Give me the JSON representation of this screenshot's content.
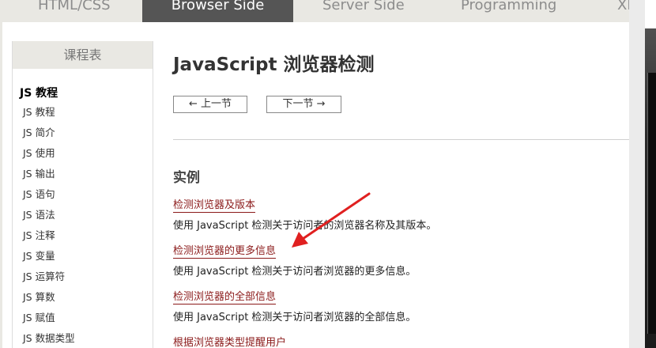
{
  "top_nav": {
    "tabs": [
      {
        "label": "HTML/CSS",
        "active": false
      },
      {
        "label": "Browser Side",
        "active": true
      },
      {
        "label": "Server Side",
        "active": false
      },
      {
        "label": "Programming",
        "active": false
      },
      {
        "label": "XI",
        "active": false
      }
    ]
  },
  "sidebar": {
    "header": "课程表",
    "group_title": "JS 教程",
    "items": [
      "JS 教程",
      "JS 简介",
      "JS 使用",
      "JS 输出",
      "JS 语句",
      "JS 语法",
      "JS 注释",
      "JS 变量",
      "JS 运算符",
      "JS 算数",
      "JS 赋值",
      "JS 数据类型"
    ]
  },
  "main": {
    "title": "JavaScript 浏览器检测",
    "prev_label": "上一节",
    "next_label": "下一节",
    "section_title": "实例",
    "examples": [
      {
        "link": "检测浏览器及版本",
        "desc": "使用 JavaScript 检测关于访问者的浏览器名称及其版本。"
      },
      {
        "link": "检测浏览器的更多信息",
        "desc": "使用 JavaScript 检测关于访问者浏览器的更多信息。"
      },
      {
        "link": "检测浏览器的全部信息",
        "desc": "使用 JavaScript 检测关于访问者浏览器的全部信息。"
      },
      {
        "link": "根据浏览器类型提醒用户",
        "desc": ""
      }
    ]
  },
  "annotation": {
    "color": "#e02020"
  },
  "icons": {
    "prev": "arrow-left-icon",
    "next": "arrow-right-icon"
  }
}
